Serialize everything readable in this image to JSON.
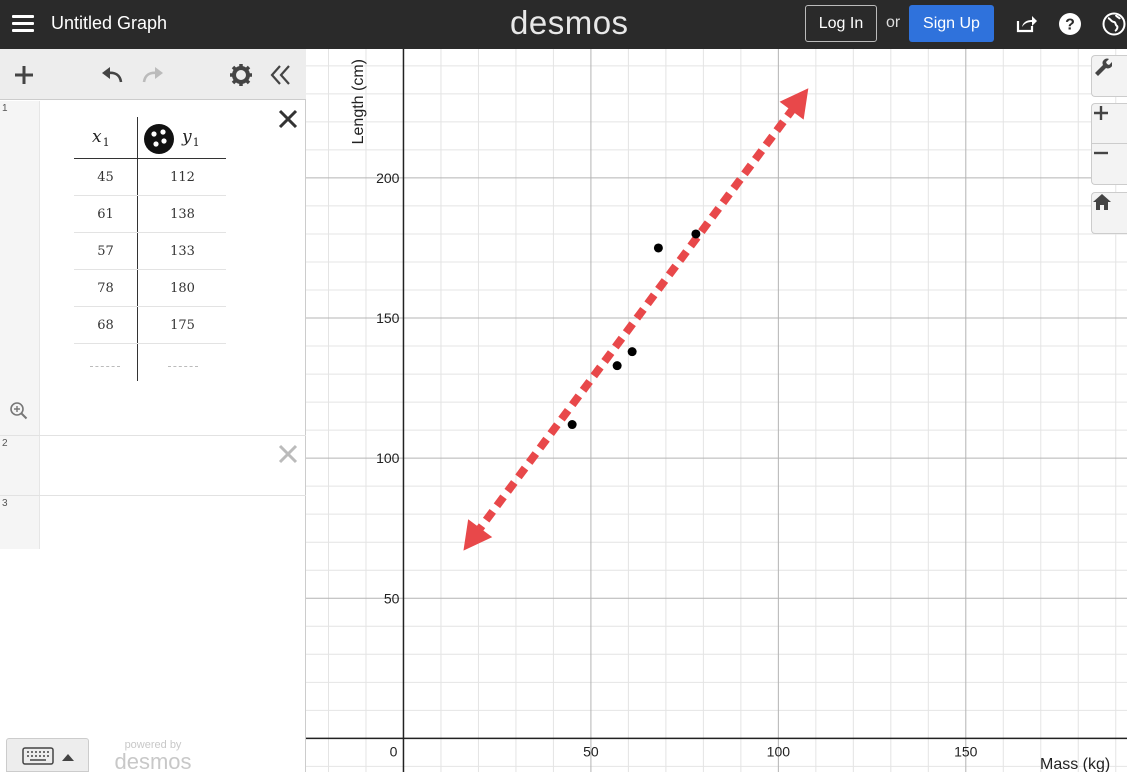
{
  "header": {
    "graph_title": "Untitled Graph",
    "logo": "desmos",
    "login_label": "Log In",
    "or_text": "or",
    "signup_label": "Sign Up",
    "colors": {
      "bar": "#2a2a2a",
      "signup": "#2f72dc"
    }
  },
  "toolbar": {
    "icons": [
      "plus-icon",
      "undo-icon",
      "redo-icon",
      "gear-icon",
      "collapse-icon"
    ]
  },
  "expressions": [
    {
      "number": "1",
      "type": "table",
      "columns": [
        "x",
        "y"
      ],
      "subscripts": [
        "1",
        "1"
      ],
      "rows": [
        [
          "45",
          "112"
        ],
        [
          "61",
          "138"
        ],
        [
          "57",
          "133"
        ],
        [
          "78",
          "180"
        ],
        [
          "68",
          "175"
        ]
      ]
    },
    {
      "number": "2",
      "type": "empty"
    },
    {
      "number": "3",
      "type": "empty"
    }
  ],
  "footer": {
    "powered_by": "powered by",
    "logo": "desmos"
  },
  "chart_data": {
    "type": "scatter",
    "xlabel": "Mass (kg)",
    "ylabel": "Length (cm)",
    "xlim": [
      -26,
      193
    ],
    "ylim": [
      -12,
      246
    ],
    "x_ticks": [
      50,
      100,
      150
    ],
    "y_ticks": [
      50,
      100,
      150,
      200
    ],
    "origin_label": "0",
    "grid": true,
    "series": [
      {
        "type": "scatter",
        "color": "#000000",
        "x": [
          45,
          61,
          57,
          78,
          68
        ],
        "y": [
          112,
          138,
          133,
          180,
          175
        ]
      }
    ],
    "annotation": {
      "type": "double-arrow-dashed",
      "color": "#e8484a",
      "from": [
        16,
        67
      ],
      "to": [
        108,
        232
      ]
    }
  }
}
